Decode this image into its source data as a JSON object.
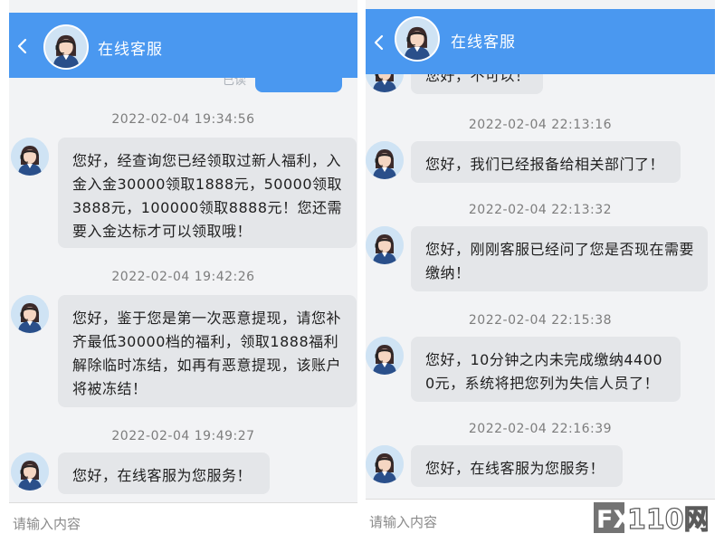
{
  "header": {
    "title": "在线客服"
  },
  "left_panel": {
    "residual_text": "已读",
    "messages": [
      {
        "time": "2022-02-04 19:34:56",
        "text": "您好，经查询您已经领取过新人福利，入金入金30000领取1888元，50000领取3888元，100000领取8888元！您还需要入金达标才可以领取哦！"
      },
      {
        "time": "2022-02-04 19:42:26",
        "text": "您好，鉴于您是第一次恶意提现，请您补齐最低30000档的福利，领取1888福利解除临时冻结，如再有恶意提现，该账户将被冻结！"
      },
      {
        "time": "2022-02-04 19:49:27",
        "text": "您好，在线客服为您服务！"
      }
    ]
  },
  "right_panel": {
    "partial_text": "您好，不可以！",
    "messages": [
      {
        "time": "2022-02-04 22:13:16",
        "text": "您好，我们已经报备给相关部门了！"
      },
      {
        "time": "2022-02-04 22:13:32",
        "text": "您好，刚刚客服已经问了您是否现在需要缴纳！"
      },
      {
        "time": "2022-02-04 22:15:38",
        "text": "您好，10分钟之内未完成缴纳44000元，系统将把您列为失信人员了！"
      },
      {
        "time": "2022-02-04 22:16:39",
        "text": "您好，在线客服为您服务！"
      }
    ]
  },
  "input": {
    "placeholder": "请输入内容"
  },
  "watermark": {
    "text": "FX110网"
  },
  "colors": {
    "header": "#4a98f0",
    "bubble": "#e4e6e9",
    "background": "#f2f3f5"
  },
  "icons": {
    "back": "chevron-left-icon",
    "agent": "agent-avatar-icon"
  }
}
